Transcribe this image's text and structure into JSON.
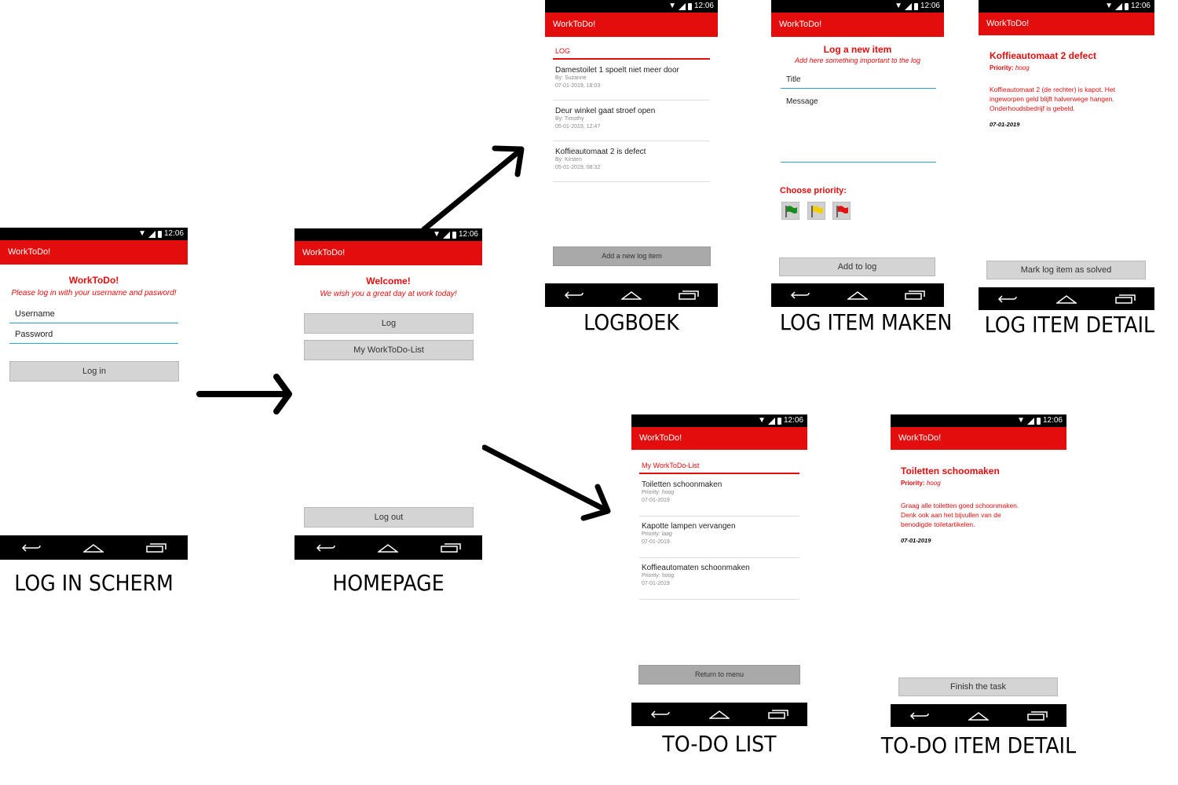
{
  "status_time": "12:06",
  "app_name": "WorkToDo!",
  "labels": {
    "login": "LOG IN SCHERM",
    "home": "HOMEPAGE",
    "logboek": "LOGBOEK",
    "log_maken": "LOG ITEM MAKEN",
    "log_detail": "LOG ITEM DETAIL",
    "todo_list": "TO-DO LIST",
    "todo_detail": "TO-DO ITEM DETAIL"
  },
  "login": {
    "title": "WorkToDo!",
    "subtitle": "Please log in with your username and pasword!",
    "username_placeholder": "Username",
    "password_placeholder": "Password",
    "login_button": "Log in"
  },
  "home": {
    "title": "Welcome!",
    "subtitle": "We wish you a great day at work today!",
    "log_button": "Log",
    "list_button": "My WorkToDo-List",
    "logout_button": "Log out"
  },
  "logboek": {
    "header": "LOG",
    "items": [
      {
        "title": "Damestoilet 1 spoelt niet meer door",
        "by": "By: Suzanne",
        "date": "07-01-2019, 18:03"
      },
      {
        "title": "Deur winkel gaat stroef open",
        "by": "By: Timothy",
        "date": "05-01-2019, 12:47"
      },
      {
        "title": "Koffieautomaat 2 is defect",
        "by": "By: Kirsten",
        "date": "05-01-2019, 08:32"
      }
    ],
    "add_button": "Add a new log item"
  },
  "log_maken": {
    "title": "Log a new item",
    "subtitle": "Add here something important to the log",
    "title_placeholder": "Title",
    "message_placeholder": "Message",
    "priority_label": "Choose priority:",
    "flag_colors": [
      "#1a8a1a",
      "#f2d000",
      "#e31010"
    ],
    "add_button": "Add to log"
  },
  "log_detail": {
    "title": "Koffieautomaat 2 defect",
    "priority_label": "Priority:",
    "priority_value": "hoog",
    "body": [
      "Koffieautomaat 2 (de rechter) is kapot. Het",
      "ingeworpen geld blijft halverwege hangen.",
      "Onderhoudsbedrijf is gebeld."
    ],
    "date": "07-01-2019",
    "solve_button": "Mark log item as solved"
  },
  "todo_list": {
    "header": "My WorkToDo-List",
    "items": [
      {
        "title": "Toiletten schoonmaken",
        "priority_label": "Priority:",
        "priority": "hoog",
        "date": "07-01-2019"
      },
      {
        "title": "Kapotte lampen vervangen",
        "priority_label": "Priority:",
        "priority": "laag",
        "date": "07-01-2019"
      },
      {
        "title": "Koffieautomaten schoonmaken",
        "priority_label": "Priority:",
        "priority": "hoog",
        "date": "07-01-2019"
      }
    ],
    "return_button": "Return to menu"
  },
  "todo_detail": {
    "title": "Toiletten schoomaken",
    "priority_label": "Priority:",
    "priority_value": "hoog",
    "body": [
      "Graag alle toiletten goed schoonmaken.",
      "Denk ook aan het bijvullen van de",
      "benodigde toiletartikelen."
    ],
    "date": "07-01-2019",
    "finish_button": "Finish the task"
  }
}
